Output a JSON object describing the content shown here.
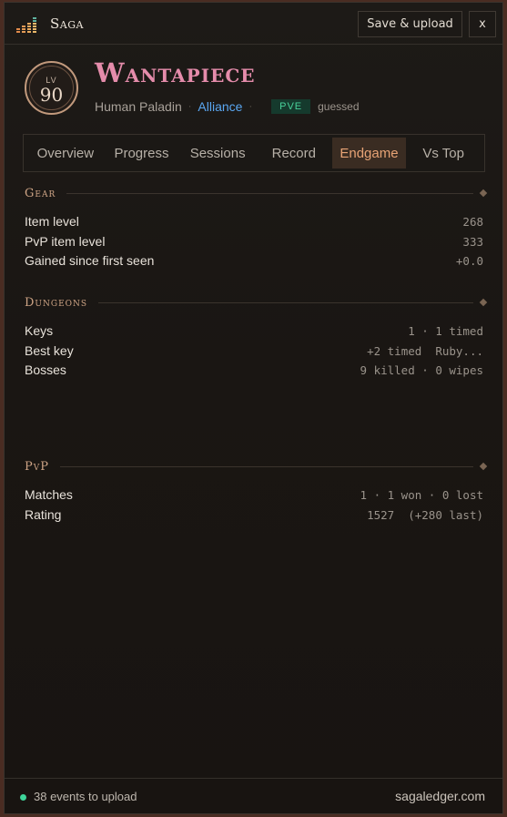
{
  "app": {
    "name": "Saga"
  },
  "toolbar": {
    "save_label": "Save & upload",
    "close_label": "x"
  },
  "character": {
    "level_label": "LV",
    "level": "90",
    "name": "Wantapiece",
    "race_class": "Human Paladin",
    "separator": "·",
    "faction": "Alliance",
    "mode": "PVE",
    "mode_note": "guessed"
  },
  "tabs": [
    "Overview",
    "Progress",
    "Sessions",
    "Record",
    "Endgame",
    "Vs Top"
  ],
  "active_tab": "Endgame",
  "sections": {
    "gear": {
      "title": "Gear",
      "rows": [
        {
          "label": "Item level",
          "value": "268"
        },
        {
          "label": "PvP item level",
          "value": "333"
        },
        {
          "label": "Gained since first seen",
          "value": "+0.0"
        }
      ]
    },
    "dungeons": {
      "title": "Dungeons",
      "rows": [
        {
          "label": "Keys",
          "value": "1 · 1 timed"
        },
        {
          "label": "Best key",
          "value": "+2 timed  Ruby..."
        },
        {
          "label": "Bosses",
          "value": "9 killed · 0 wipes"
        }
      ]
    },
    "pvp": {
      "title": "PvP",
      "rows": [
        {
          "label": "Matches",
          "value": "1 · 1 won · 0 lost"
        },
        {
          "label": "Rating",
          "value": "1527  (+280 last)"
        }
      ]
    }
  },
  "footer": {
    "status": "38 events to upload",
    "site": "sagaledger.com"
  },
  "colors": {
    "accent": "#e7a375",
    "name": "#e58cab",
    "faction": "#5aa7f2",
    "mode": "#49d19a",
    "status_dot": "#3ed49a"
  }
}
